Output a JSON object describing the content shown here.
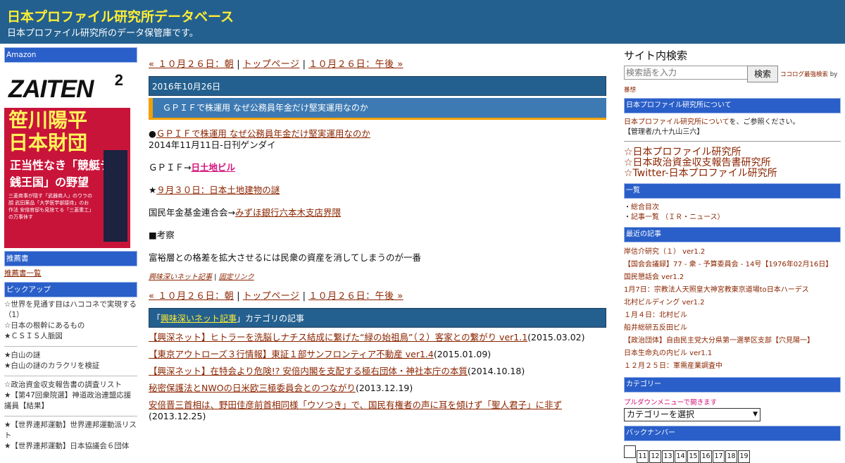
{
  "header": {
    "title": "日本プロファイル研究所データベース",
    "description": "日本プロファイル研究所のデータ保管庫です。"
  },
  "left_sidebar": {
    "amazon_label": "Amazon",
    "book": {
      "brand": "ZAITEN",
      "issue": "2",
      "headline": "笹川陽平 日本財団",
      "subhead": "正当性なき「競艇テラ銭王国」の野望",
      "blurb": "三菱商事が隠す「武器商人」のウラの顔 武田薬品「大学医学部接待」のお作法 安倍官邸も見捨てる「三菱重工」の万事休す"
    },
    "recommend_label": "推薦書",
    "recommend_link": "推薦書一覧",
    "pickup_label": "ピックアップ",
    "pickup_groups": [
      [
        "☆世界を見通す目はハココネで実現する（1）",
        "☆日本の根幹にあるもの",
        "★ＣＳＩＳ人脈図"
      ],
      [
        "★白山の謎",
        "★白山の謎のカラクリを検証"
      ],
      [
        "☆政治資金収支報告書の調査リスト",
        "★【第47回衆院選】神道政治連盟応援議員【結果】"
      ],
      [
        "★【世界連邦運動】世界連邦運動派リスト",
        "★【世界連邦運動】日本協議会６団体"
      ]
    ]
  },
  "main": {
    "nav": {
      "prev": "« １０月２６日：朝",
      "sep1": " | ",
      "top": "トップページ",
      "sep2": " | ",
      "next": "１０月２６日：午後 »"
    },
    "date": "2016年10月26日",
    "entry_title": "ＧＰＩＦで株運用 なぜ公務員年金だけ堅実運用なのか",
    "paragraphs": [
      {
        "prefix": "●",
        "link": "ＧＰＩＦで株運用 なぜ公務員年金だけ堅実運用なのか",
        "suffix": ""
      },
      {
        "prefix": "ＧＰＩＦ→",
        "link": "日土地ビル",
        "suffix": ""
      },
      {
        "prefix": "★",
        "link": "９月３０日：日本土地建物の謎",
        "suffix": ""
      },
      {
        "prefix": "国民年金基金連合会→",
        "link": "みずほ銀行六本木支店界隈",
        "suffix": ""
      }
    ],
    "source": "2014年11月11日-日刊ゲンダイ",
    "consider": "■考察",
    "conclusion": "富裕層との格差を拡大させるには民衆の資産を消してしまうのが一番",
    "meta": {
      "category": "興味深いネット記事",
      "sep": " | ",
      "permalink": "固定リンク"
    },
    "category_bar": {
      "open": "「",
      "name": "興味深いネット記事",
      "close": "」カテゴリの記事"
    },
    "category_articles": [
      {
        "title": "【興深ネット】ヒトラーを洗脳しナチス結成に繋げた“緑の始祖鳥”（２）客家との繋がり ver1.1",
        "date": "(2015.03.02)"
      },
      {
        "title": "【東京アウトローズ３行情報】東証１部サンフロンティア不動産 ver1.4",
        "date": "(2015.01.09)"
      },
      {
        "title": "【興深ネット】在特会より危険!? 安倍内閣を支配する極右団体・神社本庁の本質",
        "date": "(2014.10.18)"
      },
      {
        "title": "秘密保護法とNWOの日米欧三極委員会とのつながり",
        "date": "(2013.12.19)"
      },
      {
        "title": "安倍晋三首相は、野田佳彦前首相同様「ウソつき」で、国民有権者の声に耳を傾けず「聖人君子」に非ず",
        "date": "(2013.12.25)"
      }
    ]
  },
  "right_sidebar": {
    "search_heading": "サイト内検索",
    "search_placeholder": "検索語を入力",
    "search_button": "検索",
    "search_powered": "ココログ最強検索",
    "search_by": "by",
    "search_credit": "暴想",
    "about_label": "日本プロファイル研究所について",
    "about_link": "日本プロファイル研究所について",
    "about_text": "を、ご参照ください。",
    "admin": "【管理者/九十九山三六】",
    "big_links": [
      "☆日本プロファイル研究所",
      "☆日本政治資金収支報告書研究所",
      "☆Twitter-日本プロファイル研究所"
    ],
    "list_label": "一覧",
    "list_items": [
      "総合目次",
      "記事一覧 （ＩＲ・ニュース）"
    ],
    "recent_label": "最近の記事",
    "recent_items": [
      "岸信介研究（１） ver1.2",
      "【国会会議録】77 - 衆 - 予算委員会 - 14号【1976年02月16日】",
      "国民懇話会 ver1.2",
      "1月7日：宗教法人天照皇大神宮教東京道場to日本ハーデス",
      "北村ビルディング ver1.2",
      "１月４日：北村ビル",
      "船井総研五反田ビル",
      "【政治団体】自由民主党大分県第一選挙区支部【穴見陽一】",
      "日本生命丸の内ビル ver1.1",
      "１２月２５日：軍需産業調査中"
    ],
    "category_label": "カテゴリー",
    "category_note": "プルダウンメニューで開きます",
    "category_select": "カテゴリーを選択",
    "backnumber_label": "バックナンバー",
    "backnumbers": [
      "",
      "11",
      "12",
      "13",
      "14",
      "15",
      "16",
      "17",
      "18",
      "19"
    ]
  }
}
